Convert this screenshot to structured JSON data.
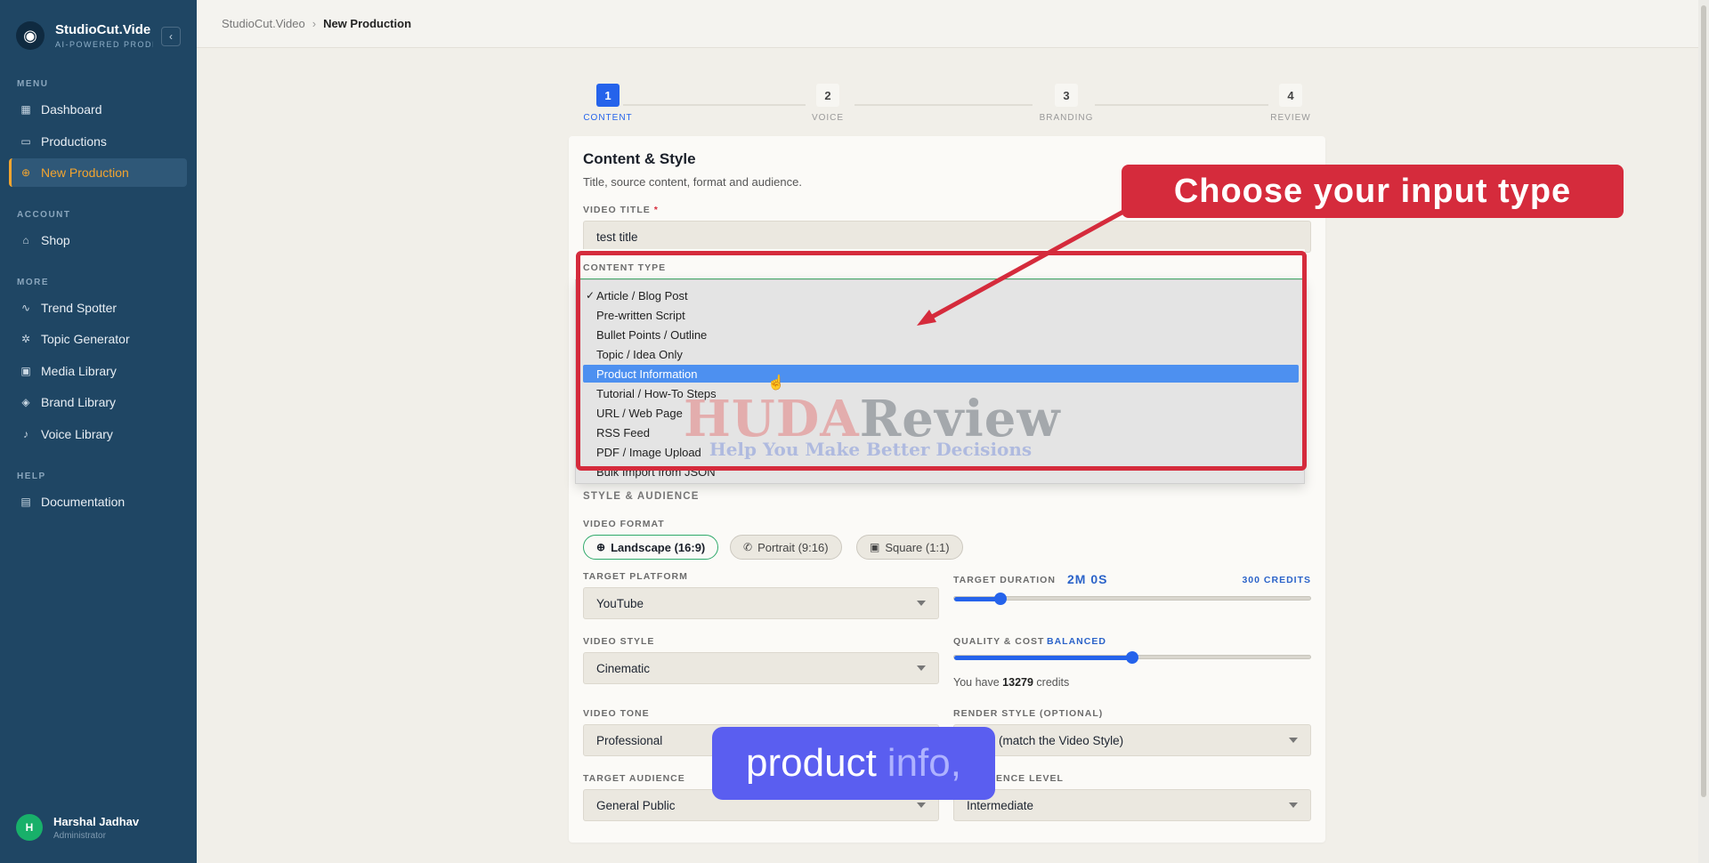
{
  "brand": {
    "name": "StudioCut.Vide",
    "tagline": "AI-POWERED PRODI",
    "logo_icon": "film-reel-icon"
  },
  "sidebar": {
    "sections": [
      {
        "label": "MENU",
        "items": [
          {
            "label": "Dashboard",
            "icon": "grid-icon"
          },
          {
            "label": "Productions",
            "icon": "folder-icon"
          },
          {
            "label": "New Production",
            "icon": "plus-circle-icon",
            "active": true
          }
        ]
      },
      {
        "label": "ACCOUNT",
        "items": [
          {
            "label": "Shop",
            "icon": "bag-icon"
          }
        ]
      },
      {
        "label": "MORE",
        "items": [
          {
            "label": "Trend Spotter",
            "icon": "activity-icon"
          },
          {
            "label": "Topic Generator",
            "icon": "sparkle-icon"
          },
          {
            "label": "Media Library",
            "icon": "image-icon"
          },
          {
            "label": "Brand Library",
            "icon": "tag-icon"
          },
          {
            "label": "Voice Library",
            "icon": "mic-icon"
          }
        ]
      },
      {
        "label": "HELP",
        "items": [
          {
            "label": "Documentation",
            "icon": "book-icon"
          }
        ]
      }
    ],
    "user": {
      "initial": "H",
      "name": "Harshal Jadhav",
      "role": "Administrator"
    }
  },
  "breadcrumb": {
    "root": "StudioCut.Video",
    "separator": "›",
    "current": "New Production"
  },
  "stepper": [
    {
      "num": "1",
      "label": "CONTENT",
      "active": true
    },
    {
      "num": "2",
      "label": "VOICE"
    },
    {
      "num": "3",
      "label": "BRANDING"
    },
    {
      "num": "4",
      "label": "REVIEW"
    }
  ],
  "form": {
    "title": "Content & Style",
    "subtitle": "Title, source content, format and audience.",
    "video_title_label": "VIDEO TITLE",
    "required_mark": "*",
    "video_title_value": "test title",
    "content_type_label": "CONTENT TYPE",
    "content_type_options": [
      "Article / Blog Post",
      "Pre-written Script",
      "Bullet Points / Outline",
      "Topic / Idea Only",
      "Product Information",
      "Tutorial / How-To Steps",
      "URL / Web Page",
      "RSS Feed",
      "PDF / Image Upload",
      "Bulk Import from JSON"
    ],
    "content_type_selected": "Article / Blog Post",
    "content_type_hovered": "Product Information",
    "check_glyph": "✓",
    "style_section": "STYLE & AUDIENCE",
    "video_format_label": "VIDEO FORMAT",
    "formats": [
      {
        "label": "Landscape (16:9)",
        "icon": "globe-icon",
        "active": true
      },
      {
        "label": "Portrait (9:16)",
        "icon": "phone-icon"
      },
      {
        "label": "Square (1:1)",
        "icon": "image-icon"
      }
    ],
    "target_platform_label": "TARGET PLATFORM",
    "target_platform_value": "YouTube",
    "target_duration_label": "TARGET DURATION",
    "target_duration_value": "2M 0S",
    "duration_credits": "300 CREDITS",
    "duration_fraction": 0.13,
    "video_style_label": "VIDEO STYLE",
    "video_style_value": "Cinematic",
    "quality_label": "QUALITY & COST",
    "quality_value": "BALANCED",
    "quality_fraction": 0.5,
    "credits_prefix": "You have",
    "credits_amount": "13279",
    "credits_suffix": "credits",
    "video_tone_label": "VIDEO TONE",
    "video_tone_value": "Professional",
    "render_style_label": "RENDER STYLE (OPTIONAL)",
    "render_style_value": "(match the Video Style)",
    "target_audience_label": "TARGET AUDIENCE",
    "target_audience_value": "General Public",
    "experience_level_label": "ENCE LEVEL",
    "experience_level_value": "Intermediate"
  },
  "overlays": {
    "callout": "Choose your input type",
    "caption_main": "product",
    "caption_dim": "info,",
    "watermark_a": "HUDA",
    "watermark_b": "Review",
    "watermark_sub": "Help You Make Better Decisions"
  },
  "colors": {
    "accent": "#2563eb",
    "sidebar": "#1f4664",
    "active_nav": "#f3a52f",
    "callout": "#d52b3c",
    "hover_option": "#4d90f0"
  }
}
